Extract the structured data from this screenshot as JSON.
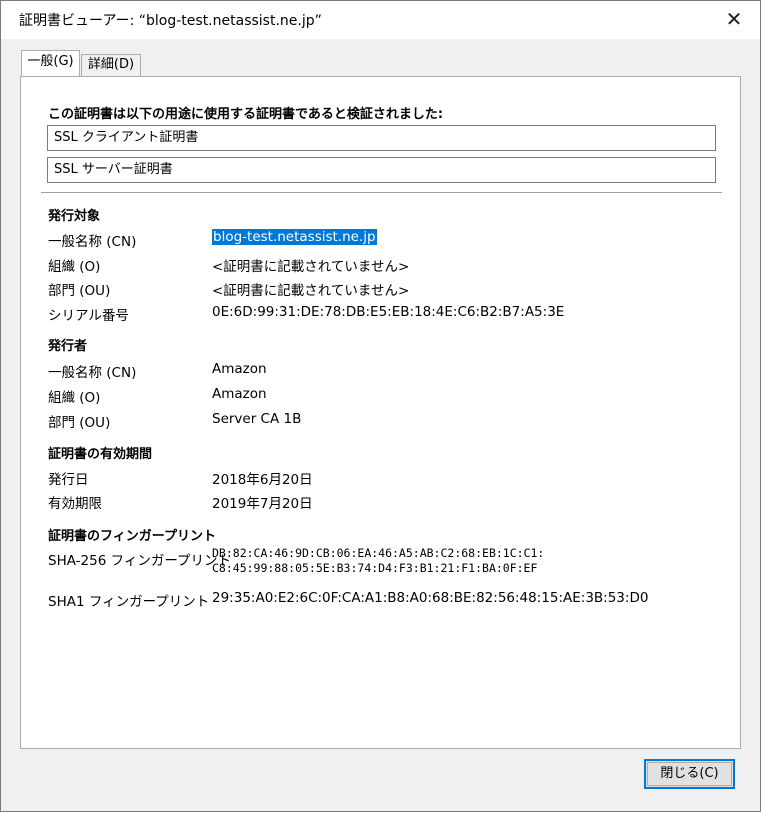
{
  "window": {
    "title": "証明書ビューアー: “blog-test.netassist.ne.jp”",
    "close_glyph": "✕"
  },
  "tabs": [
    {
      "label": "一般(G)",
      "active": true
    },
    {
      "label": "詳細(D)",
      "active": false
    }
  ],
  "general": {
    "verified_heading": "この証明書は以下の用途に使用する証明書であると検証されました:",
    "usages": [
      "SSL クライアント証明書",
      "SSL サーバー証明書"
    ],
    "issued_to": {
      "title": "発行対象",
      "rows": [
        {
          "label": "一般名称 (CN)",
          "value": "blog-test.netassist.ne.jp"
        },
        {
          "label": "組織 (O)",
          "value": "<証明書に記載されていません>"
        },
        {
          "label": "部門 (OU)",
          "value": "<証明書に記載されていません>"
        },
        {
          "label": "シリアル番号",
          "value": "0E:6D:99:31:DE:78:DB:E5:EB:18:4E:C6:B2:B7:A5:3E"
        }
      ]
    },
    "issued_by": {
      "title": "発行者",
      "rows": [
        {
          "label": "一般名称 (CN)",
          "value": "Amazon"
        },
        {
          "label": "組織 (O)",
          "value": "Amazon"
        },
        {
          "label": "部門 (OU)",
          "value": "Server CA 1B"
        }
      ]
    },
    "validity": {
      "title": "証明書の有効期間",
      "rows": [
        {
          "label": "発行日",
          "value": "2018年6月20日"
        },
        {
          "label": "有効期限",
          "value": "2019年7月20日"
        }
      ]
    },
    "fingerprints": {
      "title": "証明書のフィンガープリント",
      "sha256_label": "SHA-256 フィンガープリント",
      "sha256_line1": "DB:82:CA:46:9D:CB:06:EA:46:A5:AB:C2:68:EB:1C:C1:",
      "sha256_line2": "C8:45:99:88:05:5E:B3:74:D4:F3:B1:21:F1:BA:0F:EF",
      "sha1_label": "SHA1 フィンガープリント",
      "sha1_value": "29:35:A0:E2:6C:0F:CA:A1:B8:A0:68:BE:82:56:48:15:AE:3B:53:D0"
    }
  },
  "buttons": {
    "close_label": "閉じる(C)"
  },
  "colors": {
    "selection": "#0078d7",
    "focus_border": "#0078d7"
  }
}
